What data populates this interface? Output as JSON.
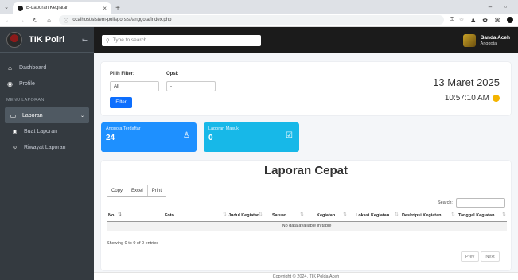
{
  "browser": {
    "tab_title": "E-Laporan Kegiatan",
    "url": "localhost/sistem-polisporsisi/anggota/index.php"
  },
  "sidebar": {
    "brand": "TIK Polri",
    "items": [
      {
        "label": "Dashboard",
        "icon": "home-icon"
      },
      {
        "label": "Profile",
        "icon": "user-circle-icon"
      }
    ],
    "section_header": "MENU LAPORAN",
    "laporan": {
      "label": "Laporan",
      "icon": "monitor-icon"
    },
    "sub_items": [
      {
        "label": "Buat Laporan",
        "icon": "file-icon"
      },
      {
        "label": "Riwayat Laporan",
        "icon": "history-icon"
      }
    ]
  },
  "topnav": {
    "search_placeholder": "Type to search...",
    "user_name": "Banda Aceh",
    "user_role": "Anggota"
  },
  "filter": {
    "filter_label": "Pilih Filter:",
    "filter_value": "All",
    "option_label": "Opsi:",
    "option_value": "-",
    "button": "Filter",
    "date": "13 Maret 2025",
    "time": "10:57:10 AM"
  },
  "stats": [
    {
      "title": "Anggota Terdaftar",
      "value": "24",
      "color": "#1e90ff"
    },
    {
      "title": "Laporan Masuk",
      "value": "0",
      "color": "#17b8e8"
    }
  ],
  "table": {
    "title": "Laporan Cepat",
    "buttons": [
      "Copy",
      "Excel",
      "Print"
    ],
    "search_label": "Search:",
    "columns": [
      "No",
      "Foto",
      "Judul Kegiatan",
      "Satuan",
      "Kegiatan",
      "Lokasi Kegiatan",
      "Deskripsi Kegiatan",
      "Tanggal Kegiatan"
    ],
    "empty": "No data available in table",
    "info": "Showing 0 to 0 of 0 entries",
    "prev": "Prev",
    "next": "Next"
  },
  "footer": "Copyright © 2024. TIK Polda Aceh"
}
